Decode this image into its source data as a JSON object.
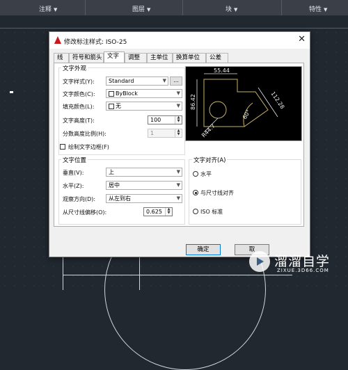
{
  "ribbon": {
    "panels": [
      "注释",
      "图层",
      "块",
      "特性"
    ]
  },
  "dialog": {
    "title": "修改标注样式: ISO-25",
    "tabs": [
      "线",
      "符号和箭头",
      "文字",
      "调整",
      "主单位",
      "换算单位",
      "公差"
    ],
    "active_tab": "文字",
    "text_appearance": {
      "group_title": "文字外观",
      "text_style_label": "文字样式(Y):",
      "text_style_value": "Standard",
      "browse_label": "...",
      "text_color_label": "文字颜色(C):",
      "text_color_value": "ByBlock",
      "fill_color_label": "填充颜色(L):",
      "fill_color_value": "无",
      "text_height_label": "文字高度(T):",
      "text_height_value": "100",
      "fraction_scale_label": "分数高度比例(H):",
      "fraction_scale_value": "1",
      "draw_frame_label": "绘制文字边框(F)"
    },
    "preview": {
      "dim_top": "55.44",
      "dim_left": "86.42",
      "dim_right": "112.28",
      "dim_angle": "60°",
      "dim_radius": "R44.7"
    },
    "text_placement": {
      "group_title": "文字位置",
      "vertical_label": "垂直(V):",
      "vertical_value": "上",
      "horizontal_label": "水平(Z):",
      "horizontal_value": "居中",
      "view_direction_label": "观察方向(D):",
      "view_direction_value": "从左到右",
      "offset_label": "从尺寸线偏移(O):",
      "offset_value": "0.625"
    },
    "text_alignment": {
      "group_title": "文字对齐(A)",
      "options": [
        "水平",
        "与尺寸线对齐",
        "ISO 标准"
      ],
      "selected": "与尺寸线对齐"
    },
    "buttons": {
      "ok": "确定",
      "cancel_partial": "取"
    },
    "colors": {
      "accent": "#0078d7",
      "app_icon": "#c8181e",
      "preview_bg": "#000000",
      "preview_geometry": "#c8b26a"
    }
  },
  "watermark": {
    "title": "溜溜自学",
    "subtitle": "ZIXUE.3D66.COM"
  }
}
